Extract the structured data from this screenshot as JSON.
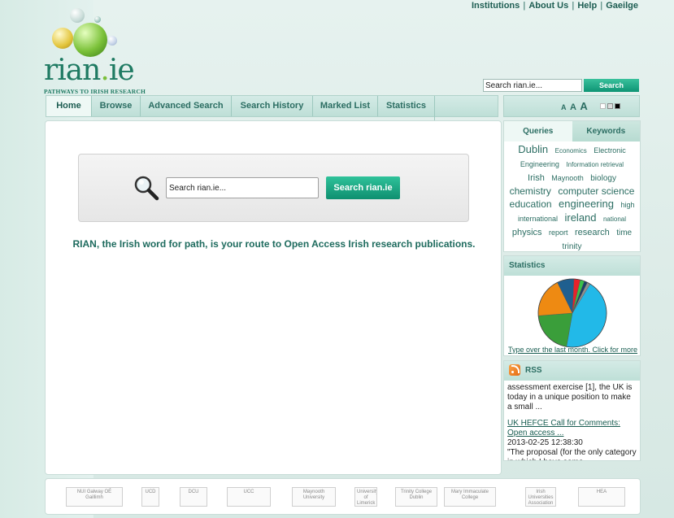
{
  "top_links": [
    "Institutions",
    "About Us",
    "Help",
    "Gaeilge"
  ],
  "logo": {
    "name_left": "rian",
    "name_dot": ".",
    "name_right": "ie",
    "tagline": "PATHWAYS TO IRISH RESEARCH"
  },
  "header_search": {
    "value": "Search rian.ie...",
    "button": "Search"
  },
  "nav": [
    "Home",
    "Browse",
    "Advanced Search",
    "Search History",
    "Marked List",
    "Statistics"
  ],
  "font_size": {
    "small": "A",
    "medium": "A",
    "large": "A"
  },
  "main": {
    "search_value": "Search rian.ie...",
    "search_button": "Search rian.ie",
    "intro": "RIAN, the Irish word for path, is your route to Open Access Irish research publications."
  },
  "cloud": {
    "tabs": [
      "Queries",
      "Keywords"
    ],
    "tags": [
      {
        "text": "Dublin",
        "size": 13
      },
      {
        "text": "Economics",
        "size": 8
      },
      {
        "text": "Electronic",
        "size": 9
      },
      {
        "text": "Engineering",
        "size": 9
      },
      {
        "text": "Information retrieval",
        "size": 8
      },
      {
        "text": "Irish",
        "size": 11
      },
      {
        "text": "Maynooth",
        "size": 9
      },
      {
        "text": "biology",
        "size": 10
      },
      {
        "text": "chemistry",
        "size": 12
      },
      {
        "text": "computer science",
        "size": 12
      },
      {
        "text": "education",
        "size": 12
      },
      {
        "text": "engineering",
        "size": 13
      },
      {
        "text": "high",
        "size": 9
      },
      {
        "text": "international",
        "size": 9
      },
      {
        "text": "ireland",
        "size": 13
      },
      {
        "text": "national",
        "size": 8
      },
      {
        "text": "physics",
        "size": 11
      },
      {
        "text": "report",
        "size": 9
      },
      {
        "text": "research",
        "size": 11
      },
      {
        "text": "time",
        "size": 10
      },
      {
        "text": "trinity",
        "size": 10
      }
    ]
  },
  "stats": {
    "title": "Statistics",
    "link": "Type over the last month. Click for more",
    "slices": [
      {
        "value": 44,
        "color": "#22b9e8"
      },
      {
        "value": 21,
        "color": "#3a9e3a"
      },
      {
        "value": 19,
        "color": "#ee8a12"
      },
      {
        "value": 8,
        "color": "#1f5f8f"
      },
      {
        "value": 3,
        "color": "#e8212b"
      },
      {
        "value": 2,
        "color": "#3ac04a"
      },
      {
        "value": 1.5,
        "color": "#1a3f6a"
      },
      {
        "value": 1.5,
        "color": "#8f8f8f"
      }
    ]
  },
  "rss": {
    "title": "RSS",
    "fragment": "assessment exercise [1], the UK is today in a unique position to make a small ...",
    "link": "UK HEFCE Call for Comments: Open access ...",
    "date": "2013-02-25 12:38:30",
    "excerpt": "\"The proposal (for the only category in which I have some"
  },
  "partners": [
    "NUI Galway OÉ Gaillimh",
    "UCD",
    "DCU",
    "UCC",
    "Maynooth University",
    "University of Limerick",
    "Trinity College Dublin",
    "Mary Immaculate College",
    "Irish Universities Association",
    "HEA"
  ]
}
